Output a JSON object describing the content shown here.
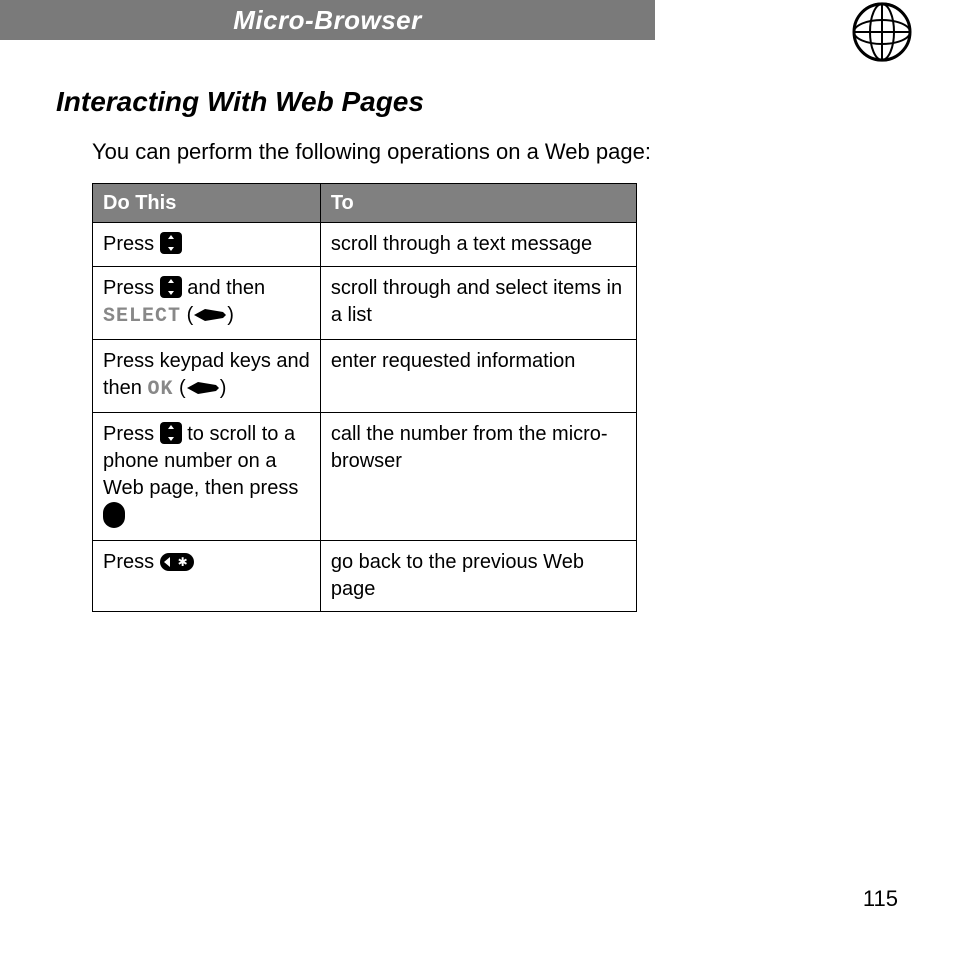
{
  "header": {
    "title": "Micro-Browser"
  },
  "section": {
    "heading": "Interacting With Web Pages",
    "intro": "You can perform the following operations on a Web page:"
  },
  "table": {
    "headers": {
      "col1": "Do This",
      "col2": "To"
    },
    "rows": [
      {
        "do_pre": "Press ",
        "do_icon1": "scroll",
        "do_mid": "",
        "do_soft": "",
        "do_post": "",
        "to": "scroll through a text message"
      },
      {
        "do_pre": "Press ",
        "do_icon1": "scroll",
        "do_mid": " and then ",
        "do_soft": "SELECT",
        "do_post": " (",
        "do_icon2": "menu",
        "do_close": ")",
        "to": "scroll through and select items in a list"
      },
      {
        "do_pre": "Press keypad keys and then ",
        "do_soft": "OK",
        "do_post": " (",
        "do_icon2": "menu",
        "do_close": ")",
        "to": "enter requested information"
      },
      {
        "do_pre": "Press ",
        "do_icon1": "scroll",
        "do_mid": " to scroll to a phone number on a Web page, then press ",
        "do_icon2": "send",
        "to": "call the number from the micro-browser"
      },
      {
        "do_pre": "Press ",
        "do_icon1": "back",
        "to": "go back to the previous Web page"
      }
    ]
  },
  "page_number": "115"
}
